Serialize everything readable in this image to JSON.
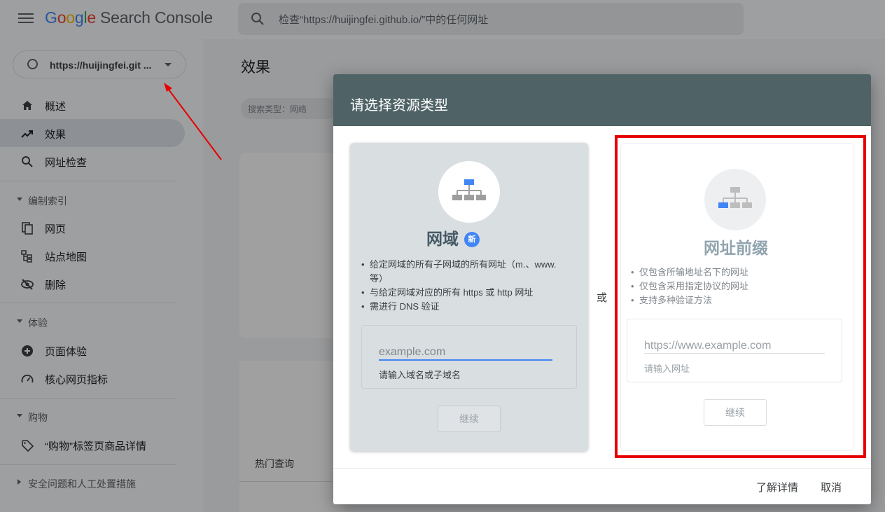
{
  "app": {
    "logo_letters": [
      "G",
      "o",
      "o",
      "g",
      "l",
      "e"
    ],
    "logo_rest": "Search Console",
    "search_placeholder": "检查“https://huijingfei.github.io/”中的任何网址"
  },
  "sidebar": {
    "property": "https://huijingfei.git ...",
    "items": [
      {
        "label": "概述",
        "icon": "home-icon",
        "active": false
      },
      {
        "label": "效果",
        "icon": "trending-up-icon",
        "active": true
      },
      {
        "label": "网址检查",
        "icon": "search-icon",
        "active": false
      }
    ],
    "sections": [
      {
        "label": "编制索引",
        "items": [
          {
            "label": "网页",
            "icon": "pages-icon"
          },
          {
            "label": "站点地图",
            "icon": "sitemap-icon"
          },
          {
            "label": "删除",
            "icon": "visibility-off-icon"
          }
        ]
      },
      {
        "label": "体验",
        "items": [
          {
            "label": "页面体验",
            "icon": "add-circle-icon"
          },
          {
            "label": "核心网页指标",
            "icon": "speed-icon"
          }
        ]
      },
      {
        "label": "购物",
        "items": [
          {
            "label": "“购物”标签页商品详情",
            "icon": "tag-icon"
          }
        ]
      },
      {
        "label": "安全问题和人工处置措施",
        "items": []
      }
    ]
  },
  "main": {
    "title": "效果",
    "filter_chip": "搜索类型：网络",
    "top_queries_label": "热门查询"
  },
  "dialog": {
    "title": "请选择资源类型",
    "or_label": "或",
    "domain": {
      "title": "网域",
      "badge": "新",
      "bullets": [
        "给定网域的所有子网域的所有网址（m.、www. 等）",
        "与给定网域对应的所有 https 或 http 网址",
        "需进行 DNS 验证"
      ],
      "input_placeholder": "example.com",
      "input_hint": "请输入域名或子域名",
      "continue_label": "继续"
    },
    "url_prefix": {
      "title": "网址前缀",
      "bullets": [
        "仅包含所输地址名下的网址",
        "仅包含采用指定协议的网址",
        "支持多种验证方法"
      ],
      "input_placeholder": "https://www.example.com",
      "input_hint": "请输入网址",
      "continue_label": "继续"
    },
    "footer": {
      "learn_more": "了解详情",
      "cancel": "取消"
    }
  },
  "colors": {
    "dialog_header": "#4f6367",
    "accent_blue": "#4285f4",
    "annotation_red": "#e60000"
  }
}
